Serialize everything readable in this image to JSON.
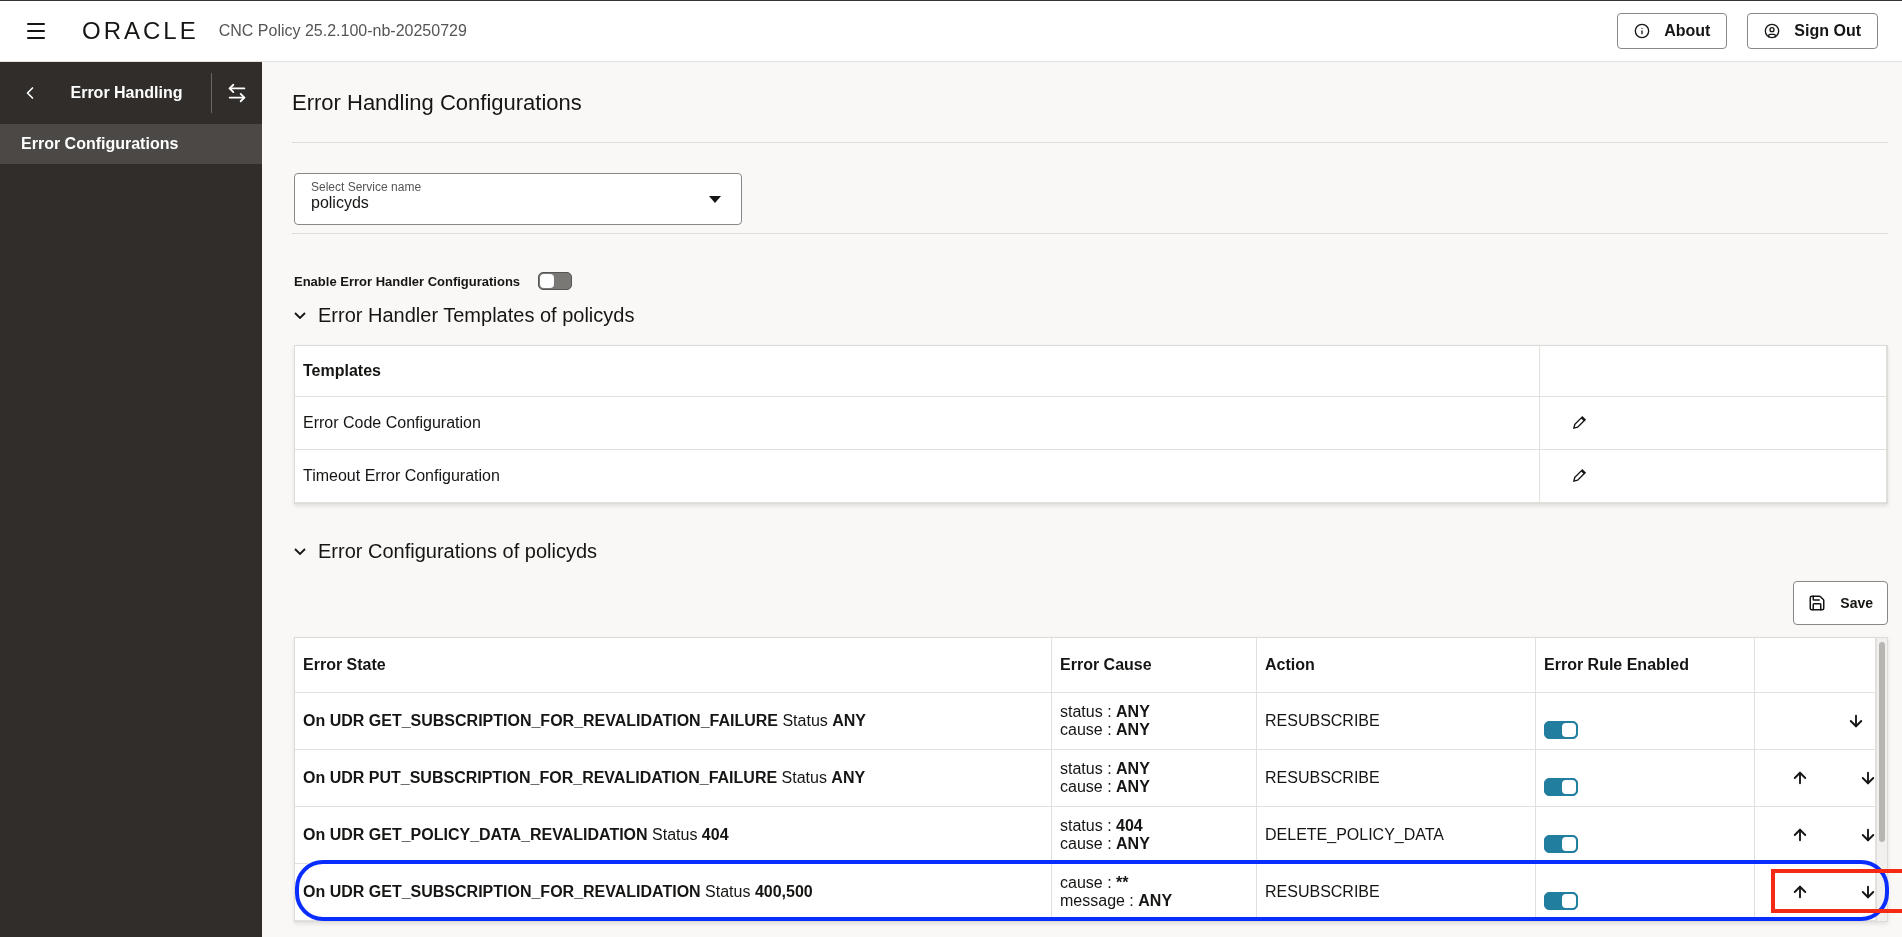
{
  "header": {
    "brand": "ORACLE",
    "product": "CNC Policy 25.2.100-nb-20250729",
    "buttons": [
      {
        "kind": "info",
        "label": "About"
      },
      {
        "kind": "user",
        "label": "Sign Out"
      }
    ]
  },
  "sidebar": {
    "title": "Error Handling",
    "items": [
      {
        "label": "Error Configurations",
        "selected": true
      }
    ]
  },
  "page_title": "Error Handling Configurations",
  "service_select": {
    "label": "Select Service name",
    "value": "policyds"
  },
  "enable_toggle": {
    "label": "Enable Error Handler Configurations",
    "on": false
  },
  "templates_section": {
    "title": "Error Handler Templates of policyds",
    "expanded": true,
    "columns": [
      "Templates"
    ],
    "rows": [
      "Error Code Configuration",
      "Timeout Error Configuration"
    ]
  },
  "errors_section": {
    "title": "Error Configurations of policyds",
    "expanded": true,
    "save_label": "Save",
    "columns": [
      "Error State",
      "Error Cause",
      "Action",
      "Error Rule Enabled"
    ],
    "rows": [
      {
        "state": "**On UDR GET_SUBSCRIPTION_FOR_REVALIDATION_FAILURE** Status **ANY**",
        "cause": [
          {
            "label": "status :",
            "value": "ANY"
          },
          {
            "label": "cause :",
            "value": "ANY"
          }
        ],
        "action": "RESUBSCRIBE",
        "enabled": true,
        "can_move_up": false,
        "can_move_down": true,
        "highlighted": false
      },
      {
        "state": "**On UDR PUT_SUBSCRIPTION_FOR_REVALIDATION_FAILURE** Status **ANY**",
        "cause": [
          {
            "label": "status :",
            "value": "ANY"
          },
          {
            "label": "cause :",
            "value": "ANY"
          }
        ],
        "action": "RESUBSCRIBE",
        "enabled": true,
        "can_move_up": true,
        "can_move_down": true,
        "highlighted": false
      },
      {
        "state": "**On UDR GET_POLICY_DATA_REVALIDATION** Status **404**",
        "cause": [
          {
            "label": "status :",
            "value": "404"
          },
          {
            "label": "cause :",
            "value": "ANY"
          }
        ],
        "action": "DELETE_POLICY_DATA",
        "enabled": true,
        "can_move_up": true,
        "can_move_down": true,
        "highlighted": false
      },
      {
        "state": "**On UDR GET_SUBSCRIPTION_FOR_REVALIDATION** Status **400,500**",
        "cause": [
          {
            "label": "cause :",
            "value": "**"
          },
          {
            "label": "message :",
            "value": "ANY"
          }
        ],
        "action": "RESUBSCRIBE",
        "enabled": true,
        "can_move_up": true,
        "can_move_down": true,
        "highlighted": true
      }
    ]
  }
}
